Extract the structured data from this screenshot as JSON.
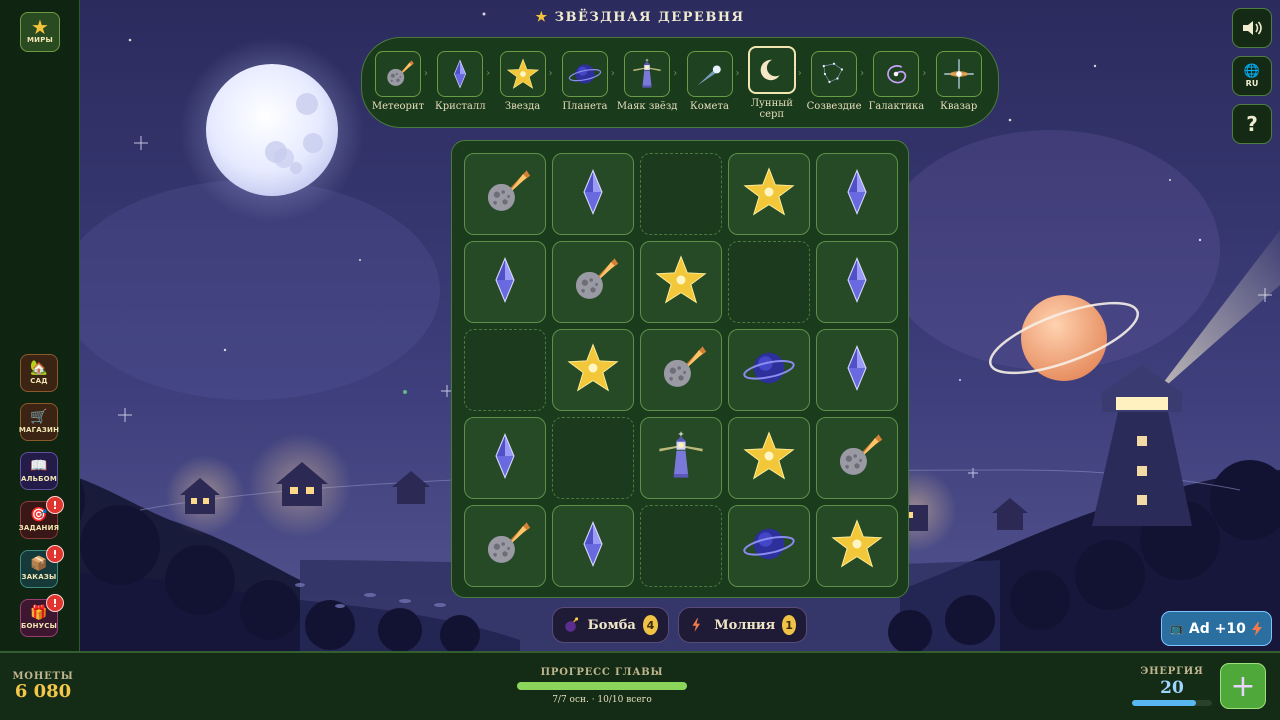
{
  "header": {
    "title": "ЗВЁЗДНАЯ ДЕРЕВНЯ"
  },
  "left_menu": [
    {
      "key": "worlds",
      "label": "МИРЫ",
      "icon": "star-icon"
    },
    {
      "key": "garden",
      "label": "САД",
      "icon": "house-icon"
    },
    {
      "key": "shop",
      "label": "МАГАЗИН",
      "icon": "cart-icon"
    },
    {
      "key": "album",
      "label": "АЛЬБОМ",
      "icon": "book-icon"
    },
    {
      "key": "tasks",
      "label": "ЗАДАНИЯ",
      "icon": "target-icon",
      "badge": "!"
    },
    {
      "key": "orders",
      "label": "ЗАКАЗЫ",
      "icon": "box-icon",
      "badge": "!"
    },
    {
      "key": "bonuses",
      "label": "БОНУСЫ",
      "icon": "gift-icon",
      "badge": "!"
    }
  ],
  "merge_chain": {
    "current_index": 6,
    "items": [
      {
        "name": "Метеорит",
        "icon": "meteor"
      },
      {
        "name": "Кристалл",
        "icon": "crystal"
      },
      {
        "name": "Звезда",
        "icon": "star"
      },
      {
        "name": "Планета",
        "icon": "planet"
      },
      {
        "name": "Маяк звёзд",
        "icon": "lighthouse"
      },
      {
        "name": "Комета",
        "icon": "comet"
      },
      {
        "name": "Лунный серп",
        "icon": "crescent"
      },
      {
        "name": "Созвездие",
        "icon": "constellation"
      },
      {
        "name": "Галактика",
        "icon": "galaxy"
      },
      {
        "name": "Квазар",
        "icon": "quasar"
      }
    ]
  },
  "board": {
    "rows": [
      [
        "meteor",
        "crystal",
        "empty",
        "star",
        "crystal"
      ],
      [
        "crystal",
        "meteor",
        "star",
        "empty",
        "crystal"
      ],
      [
        "empty",
        "star",
        "meteor",
        "planet",
        "crystal"
      ],
      [
        "crystal",
        "empty",
        "lighthouse",
        "star",
        "meteor"
      ],
      [
        "meteor",
        "crystal",
        "empty",
        "planet",
        "star"
      ]
    ]
  },
  "right_controls": {
    "sound_icon": "speaker-icon",
    "language": "RU",
    "help": "?"
  },
  "powerups": [
    {
      "name": "Бомба",
      "count": "4",
      "icon": "bomb-icon"
    },
    {
      "name": "Молния",
      "count": "1",
      "icon": "lightning-icon"
    }
  ],
  "ad_button": {
    "label": "Ad +10"
  },
  "footer": {
    "coins_label": "МОНЕТЫ",
    "coins_value": "6 080",
    "progress_label": "ПРОГРЕСС ГЛАВЫ",
    "progress_text": "7/7 осн. · 10/10 всего",
    "progress_fraction": 1.0,
    "energy_label": "ЭНЕРГИЯ",
    "energy_value": "20",
    "energy_fraction": 0.8
  },
  "colors": {
    "accent_green": "#4fa83a",
    "gold": "#f3c74a",
    "energy_blue": "#58b6f0",
    "panel_dark": "#142b15"
  }
}
